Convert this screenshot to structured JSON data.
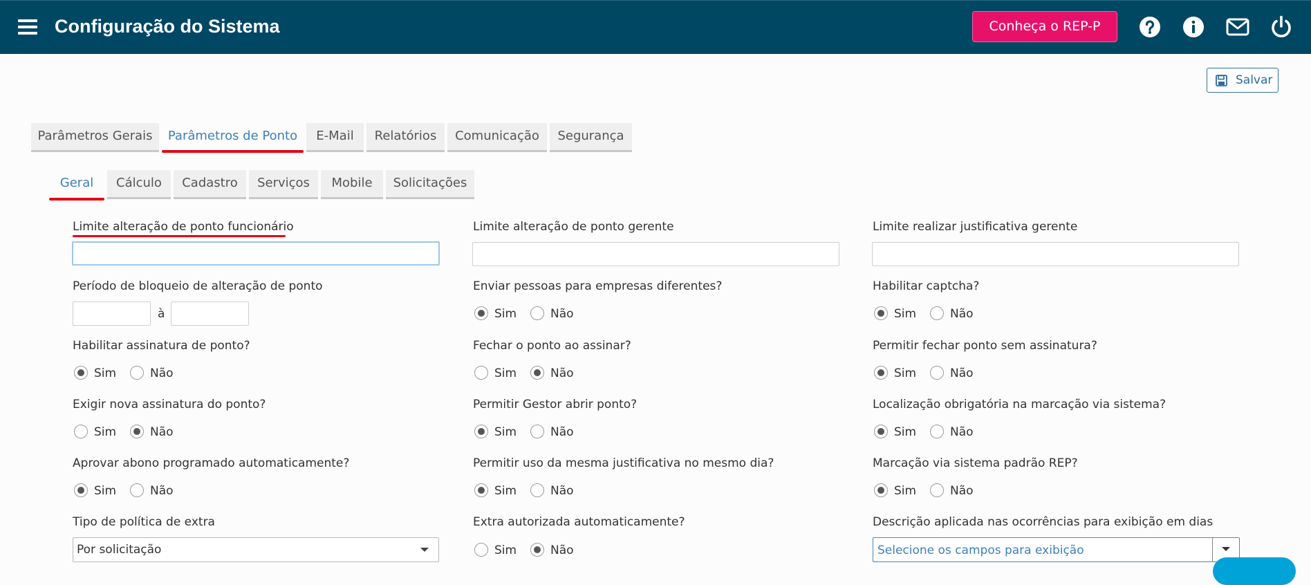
{
  "header": {
    "title": "Configuração do Sistema",
    "cta_label": "Conheça o REP-P",
    "icons": [
      "help-icon",
      "info-icon",
      "mail-icon",
      "power-icon"
    ]
  },
  "toolbar": {
    "save_label": "Salvar"
  },
  "main_tabs": [
    {
      "label": "Parâmetros Gerais",
      "active": false
    },
    {
      "label": "Parâmetros de Ponto",
      "active": true
    },
    {
      "label": "E-Mail",
      "active": false
    },
    {
      "label": "Relatórios",
      "active": false
    },
    {
      "label": "Comunicação",
      "active": false
    },
    {
      "label": "Segurança",
      "active": false
    }
  ],
  "sub_tabs": [
    {
      "label": "Geral",
      "active": true
    },
    {
      "label": "Cálculo",
      "active": false
    },
    {
      "label": "Cadastro",
      "active": false
    },
    {
      "label": "Serviços",
      "active": false
    },
    {
      "label": "Mobile",
      "active": false
    },
    {
      "label": "Solicitações",
      "active": false
    }
  ],
  "radio_options": {
    "yes": "Sim",
    "no": "Não"
  },
  "fields": {
    "limite_func": {
      "label": "Limite alteração de ponto funcionário",
      "value": ""
    },
    "limite_gerente": {
      "label": "Limite alteração de ponto gerente",
      "value": ""
    },
    "limite_justificativa": {
      "label": "Limite realizar justificativa gerente",
      "value": ""
    },
    "periodo_bloqueio": {
      "label": "Período de bloqueio de alteração de ponto",
      "from": "",
      "to": "",
      "separator": "à"
    },
    "enviar_pessoas": {
      "label": "Enviar pessoas para empresas diferentes?",
      "selected": "Sim"
    },
    "habilitar_captcha": {
      "label": "Habilitar captcha?",
      "selected": "Sim"
    },
    "habilitar_assinatura": {
      "label": "Habilitar assinatura de ponto?",
      "selected": "Sim"
    },
    "fechar_ao_assinar": {
      "label": "Fechar o ponto ao assinar?",
      "selected": "Não"
    },
    "fechar_sem_assinatura": {
      "label": "Permitir fechar ponto sem assinatura?",
      "selected": "Sim"
    },
    "exigir_nova_assinatura": {
      "label": "Exigir nova assinatura do ponto?",
      "selected": "Não"
    },
    "gestor_abrir": {
      "label": "Permitir Gestor abrir ponto?",
      "selected": "Sim"
    },
    "localizacao_obrigatoria": {
      "label": "Localização obrigatória na marcação via sistema?",
      "selected": "Sim"
    },
    "aprovar_abono": {
      "label": "Aprovar abono programado automaticamente?",
      "selected": "Sim"
    },
    "mesma_justificativa": {
      "label": "Permitir uso da mesma justificativa no mesmo dia?",
      "selected": "Sim"
    },
    "marcacao_padrao_rep": {
      "label": "Marcação via sistema padrão REP?",
      "selected": "Sim"
    },
    "tipo_politica_extra": {
      "label": "Tipo de política de extra",
      "value": "Por solicitação"
    },
    "extra_autorizada": {
      "label": "Extra autorizada automaticamente?",
      "selected": "Não"
    },
    "descricao_ocorrencias": {
      "label": "Descrição aplicada nas ocorrências para exibição em dias",
      "placeholder": "Selecione os campos para exibição"
    }
  },
  "colors": {
    "header_bg": "#004763",
    "cta_bg": "#e8116a",
    "active_tab_text": "#3e7fb8",
    "highlight_underline": "#e30613"
  }
}
